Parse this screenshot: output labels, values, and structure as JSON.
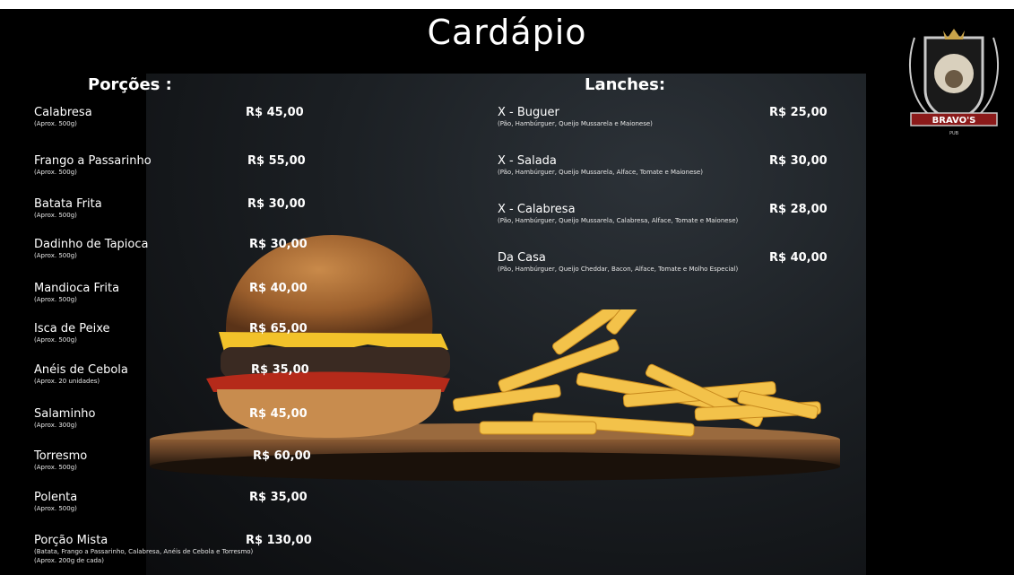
{
  "title": "Cardápio",
  "logo": {
    "text": "BRAVO'S",
    "subtext": "PUB"
  },
  "porcoes": {
    "heading": "Porções :",
    "items": [
      {
        "name": "Calabresa",
        "note": "(Aprox. 500g)",
        "price": "R$ 45,00"
      },
      {
        "name": "Frango a Passarinho",
        "note": "(Aprox. 500g)",
        "price": "R$ 55,00"
      },
      {
        "name": "Batata Frita",
        "note": "(Aprox. 500g)",
        "price": "R$ 30,00"
      },
      {
        "name": "Dadinho de Tapioca",
        "note": "(Aprox. 500g)",
        "price": "R$ 30,00"
      },
      {
        "name": "Mandioca Frita",
        "note": "(Aprox. 500g)",
        "price": "R$ 40,00"
      },
      {
        "name": "Isca de Peixe",
        "note": "(Aprox. 500g)",
        "price": "R$ 65,00"
      },
      {
        "name": "Anéis de Cebola",
        "note": "(Aprox. 20 unidades)",
        "price": "R$ 35,00"
      },
      {
        "name": "Salaminho",
        "note": "(Aprox. 300g)",
        "price": "R$ 45,00"
      },
      {
        "name": "Torresmo",
        "note": "(Aprox. 500g)",
        "price": "R$ 60,00"
      },
      {
        "name": "Polenta",
        "note": "(Aprox. 500g)",
        "price": "R$ 35,00"
      },
      {
        "name": "Porção Mista",
        "note": "(Batata, Frango a Passarinho, Calabresa, Anéis de Cebola e Torresmo)",
        "note2": "(Aprox. 200g de cada)",
        "price": "R$ 130,00"
      }
    ]
  },
  "lanches": {
    "heading": "Lanches:",
    "items": [
      {
        "name": "X - Buguer",
        "note": "(Pão, Hambúrguer, Queijo Mussarela e Maionese)",
        "price": "R$ 25,00"
      },
      {
        "name": "X - Salada",
        "note": "(Pão, Hambúrguer, Queijo Mussarela, Alface, Tomate e Maionese)",
        "price": "R$ 30,00"
      },
      {
        "name": "X - Calabresa",
        "note": "(Pão, Hambúrguer, Queijo Mussarela, Calabresa, Alface, Tomate e Maionese)",
        "price": "R$ 28,00"
      },
      {
        "name": "Da Casa",
        "note": "(Pão, Hambúrguer, Queijo Cheddar, Bacon, Alface, Tomate e Molho Especial)",
        "price": "R$ 40,00"
      }
    ]
  },
  "colors": {
    "background": "#000000",
    "text": "#ffffff",
    "logo_gold": "#c9a44a",
    "logo_red": "#8b1a1a"
  },
  "icons": {
    "logo": "lion-crest-icon",
    "hero": "burger-and-fries-photo"
  }
}
